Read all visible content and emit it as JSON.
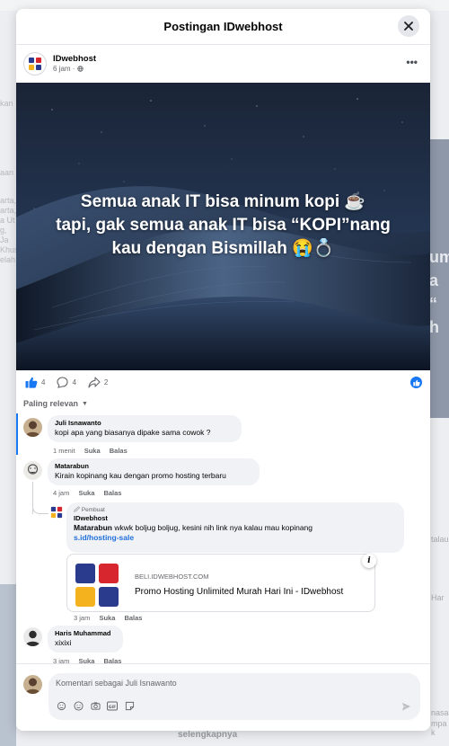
{
  "modal": {
    "title": "Postingan IDwebhost",
    "close_label": "✕"
  },
  "post": {
    "author": "IDwebhost",
    "time": "6 jam · ",
    "more": "•••",
    "image_text": {
      "line1": "Semua anak IT bisa minum kopi ☕",
      "line2": "tapi, gak semua anak IT bisa “KOPI”nang",
      "line3": "kau dengan Bismillah 😭💍"
    }
  },
  "reactions": {
    "likes": "4",
    "comments": "4",
    "shares": "2"
  },
  "sort": {
    "label": "Paling relevan",
    "chevron": "▼"
  },
  "comments": [
    {
      "name": "Juli Isnawanto",
      "text": "kopi apa yang biasanya dipake sama cowok ?",
      "time": "1 menit",
      "like": "Suka",
      "reply": "Balas"
    },
    {
      "name": "Matarabun",
      "text": "Kirain kopinang kau dengan promo hosting terbaru",
      "time": "4 jam",
      "like": "Suka",
      "reply": "Balas"
    },
    {
      "badge": "🖉 Pembuat",
      "name": "IDwebhost",
      "mention": "Matarabun",
      "text": " wkwk boljug boljug, kesini nih link nya kalau mau kopinang",
      "link": "s.id/hosting-sale",
      "time": "3 jam",
      "like": "Suka",
      "reply": "Balas"
    },
    {
      "name": "Haris Muhammad",
      "text": "xixixi",
      "time": "3 jam",
      "like": "Suka",
      "reply": "Balas"
    }
  ],
  "link_preview": {
    "domain": "BELI.IDWEBHOST.COM",
    "title": "Promo Hosting Unlimited Murah Hari Ini - IDwebhost",
    "info": "i"
  },
  "composer": {
    "placeholder": "Komentari sebagai Juli Isnawanto"
  },
  "background": {
    "bottom_text": "selengkapnya",
    "left_lines": [
      "kan",
      "aan",
      "arta,",
      "arta,",
      "a Ut",
      "g, Ja",
      "Khus",
      "elah"
    ],
    "right_card": [
      "um",
      "a “",
      "h"
    ],
    "right_bits": [
      "talau",
      "Har",
      "nasal",
      "mpa k"
    ]
  },
  "colors": {
    "brand_blue": "#1877f2",
    "logo_red": "#d7262e",
    "logo_navy": "#2a3a8c",
    "logo_yellow": "#f4b21f"
  }
}
